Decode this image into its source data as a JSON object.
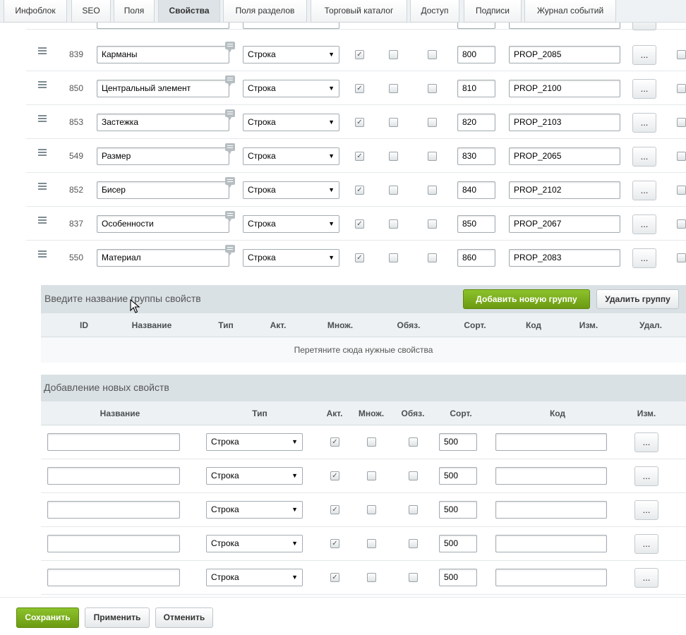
{
  "tabs": [
    {
      "label": "Инфоблок",
      "active": false
    },
    {
      "label": "SEO",
      "active": false
    },
    {
      "label": "Поля",
      "active": false
    },
    {
      "label": "Свойства",
      "active": true
    },
    {
      "label": "Поля разделов",
      "active": false
    },
    {
      "label": "Торговый каталог",
      "active": false
    },
    {
      "label": "Доступ",
      "active": false
    },
    {
      "label": "Подписи",
      "active": false
    },
    {
      "label": "Журнал событий",
      "active": false
    }
  ],
  "properties": [
    {
      "id": "839",
      "name": "Карманы",
      "type": "Строка",
      "active": true,
      "multiple": false,
      "required": false,
      "sort": "800",
      "code": "PROP_2085",
      "edit": "..."
    },
    {
      "id": "850",
      "name": "Центральный элемент",
      "type": "Строка",
      "active": true,
      "multiple": false,
      "required": false,
      "sort": "810",
      "code": "PROP_2100",
      "edit": "..."
    },
    {
      "id": "853",
      "name": "Застежка",
      "type": "Строка",
      "active": true,
      "multiple": false,
      "required": false,
      "sort": "820",
      "code": "PROP_2103",
      "edit": "..."
    },
    {
      "id": "549",
      "name": "Размер",
      "type": "Строка",
      "active": true,
      "multiple": false,
      "required": false,
      "sort": "830",
      "code": "PROP_2065",
      "edit": "..."
    },
    {
      "id": "852",
      "name": "Бисер",
      "type": "Строка",
      "active": true,
      "multiple": false,
      "required": false,
      "sort": "840",
      "code": "PROP_2102",
      "edit": "..."
    },
    {
      "id": "837",
      "name": "Особенности",
      "type": "Строка",
      "active": true,
      "multiple": false,
      "required": false,
      "sort": "850",
      "code": "PROP_2067",
      "edit": "..."
    },
    {
      "id": "550",
      "name": "Материал",
      "type": "Строка",
      "active": true,
      "multiple": false,
      "required": false,
      "sort": "860",
      "code": "PROP_2083",
      "edit": "..."
    }
  ],
  "group": {
    "title": "Введите название группы свойств",
    "add_button": "Добавить новую группу",
    "delete_button": "Удалить группу",
    "columns": [
      "ID",
      "Название",
      "Тип",
      "Акт.",
      "Множ.",
      "Обяз.",
      "Сорт.",
      "Код",
      "Изм.",
      "Удал."
    ],
    "drop_hint": "Перетяните сюда нужные свойства"
  },
  "new_props": {
    "title": "Добавление новых свойств",
    "columns": [
      "Название",
      "Тип",
      "Акт.",
      "Множ.",
      "Обяз.",
      "Сорт.",
      "Код",
      "Изм."
    ],
    "rows": [
      {
        "name": "",
        "type": "Строка",
        "active": true,
        "multiple": false,
        "required": false,
        "sort": "500",
        "code": "",
        "edit": "..."
      },
      {
        "name": "",
        "type": "Строка",
        "active": true,
        "multiple": false,
        "required": false,
        "sort": "500",
        "code": "",
        "edit": "..."
      },
      {
        "name": "",
        "type": "Строка",
        "active": true,
        "multiple": false,
        "required": false,
        "sort": "500",
        "code": "",
        "edit": "..."
      },
      {
        "name": "",
        "type": "Строка",
        "active": true,
        "multiple": false,
        "required": false,
        "sort": "500",
        "code": "",
        "edit": "..."
      },
      {
        "name": "",
        "type": "Строка",
        "active": true,
        "multiple": false,
        "required": false,
        "sort": "500",
        "code": "",
        "edit": "..."
      }
    ]
  },
  "footer": {
    "save": "Сохранить",
    "apply": "Применить",
    "cancel": "Отменить"
  },
  "colors": {
    "accent_green": "#7aab1b",
    "header_gray": "#dae1e5"
  }
}
